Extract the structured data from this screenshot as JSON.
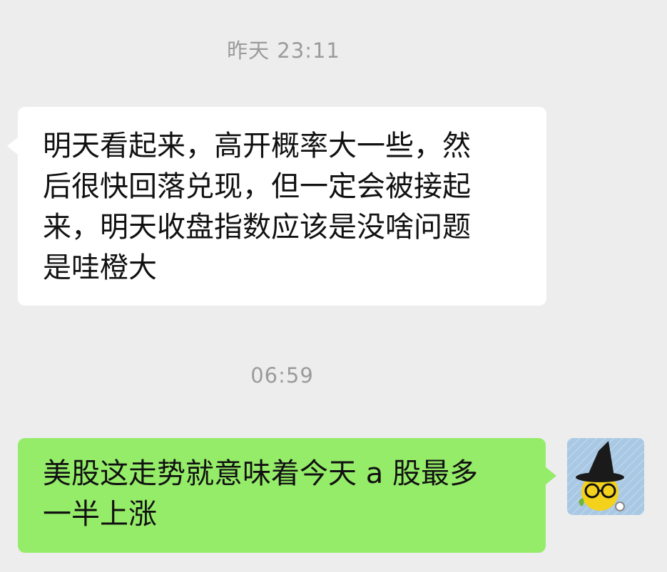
{
  "chat": {
    "timestamp_1": "昨天 23:11",
    "incoming_message": "明天看起来，高开概率大一些，然\n后很快回落兑现，但一定会被接起\n来，明天收盘指数应该是没啥问题\n是哇橙大",
    "timestamp_2": "06:59",
    "outgoing_message": "美股这走势就意味着今天 a 股最多\n一半上涨"
  },
  "colors": {
    "background": "#ededed",
    "incoming_bubble": "#ffffff",
    "outgoing_bubble": "#95ec69",
    "timestamp_text": "#9b9b9b"
  },
  "icons": {
    "avatar": "witch-hat-smiley-avatar"
  }
}
